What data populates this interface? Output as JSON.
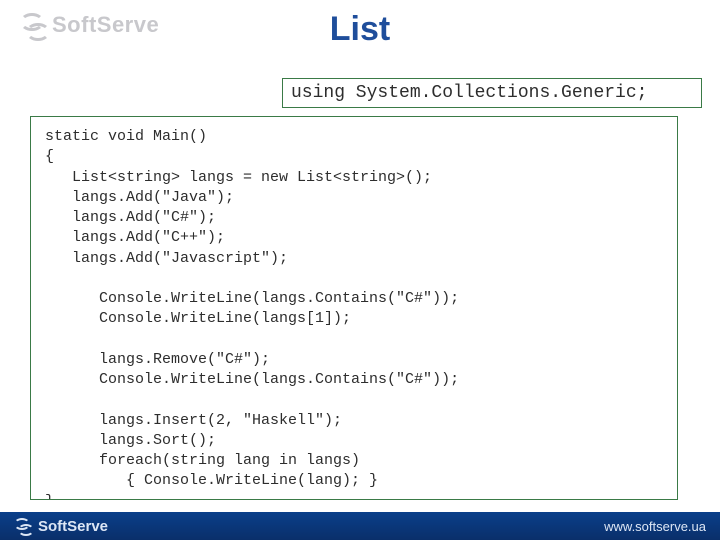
{
  "brand": {
    "name": "SoftServe"
  },
  "title": "List",
  "using_line": "using System.Collections.Generic;",
  "code": "static void Main()\n{\n   List<string> langs = new List<string>();\n   langs.Add(\"Java\");\n   langs.Add(\"C#\");\n   langs.Add(\"C++\");\n   langs.Add(\"Javascript\");\n\n      Console.WriteLine(langs.Contains(\"C#\"));\n      Console.WriteLine(langs[1]);\n\n      langs.Remove(\"C#\");\n      Console.WriteLine(langs.Contains(\"C#\"));\n\n      langs.Insert(2, \"Haskell\");\n      langs.Sort();\n      foreach(string lang in langs)\n         { Console.WriteLine(lang); }\n}",
  "footer": {
    "brand": "SoftServe",
    "url": "www.softserve.ua"
  }
}
